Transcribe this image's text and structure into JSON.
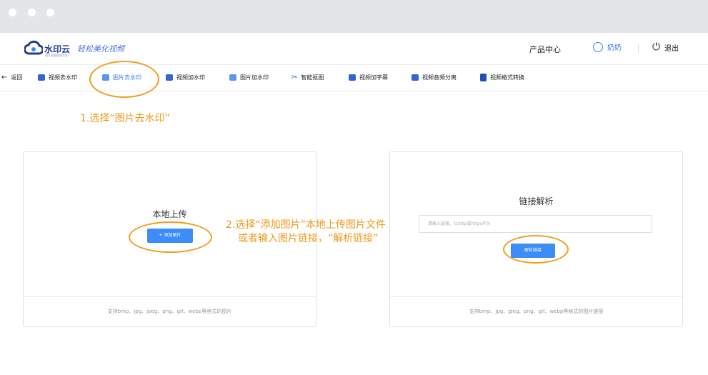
{
  "header": {
    "logo_text": "水印云",
    "logo_sub": "图片视频处理专家",
    "slogan": "轻松美化视频",
    "product_center": "产品中心",
    "username": "奶奶",
    "logout": "退出"
  },
  "nav": {
    "back": "返回",
    "items": [
      {
        "label": "视频去水印",
        "icon": "video-icon"
      },
      {
        "label": "图片去水印",
        "icon": "image-icon",
        "active": true
      },
      {
        "label": "视频加水印",
        "icon": "video-icon"
      },
      {
        "label": "图片加水印",
        "icon": "image-icon"
      },
      {
        "label": "智能抠图",
        "icon": "cutout-icon"
      },
      {
        "label": "视频加字幕",
        "icon": "video-icon"
      },
      {
        "label": "视频音频分离",
        "icon": "video-icon"
      },
      {
        "label": "视频格式转换",
        "icon": "format-icon"
      }
    ]
  },
  "annotations": {
    "step1": "1.选择“图片去水印”",
    "step2_line1": "2.选择“添加图片”本地上传图片文件",
    "step2_line2": "或者输入图片链接，“解析链接”"
  },
  "upload_card": {
    "title": "本地上传",
    "button": "+ 添加图片",
    "footer": "支持bmp、jpg、jpeg、png、gif、webp等格式的图片"
  },
  "link_card": {
    "title": "链接解析",
    "placeholder": "请输入链接，以http或https开头",
    "button": "解析链接",
    "footer": "支持bmp、jpg、jpeg、png、gif、webp等格式的图片链接"
  },
  "colors": {
    "accent": "#3c8df7",
    "annotation": "#f09a1b",
    "titlebar": "#e4e5e9"
  }
}
